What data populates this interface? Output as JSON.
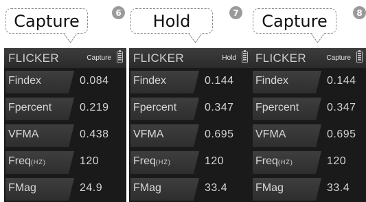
{
  "panels": [
    {
      "callout": "Capture",
      "step": "6",
      "title": "FLICKER",
      "mode": "Capture",
      "rows": [
        {
          "label": "Findex",
          "unit": "",
          "value": "0.084"
        },
        {
          "label": "Fpercent",
          "unit": "",
          "value": "0.219"
        },
        {
          "label": "VFMA",
          "unit": "",
          "value": "0.438"
        },
        {
          "label": "Freq",
          "unit": "(HZ)",
          "value": "120"
        },
        {
          "label": "FMag",
          "unit": "",
          "value": "24.9"
        }
      ]
    },
    {
      "callout": "Hold",
      "step": "7",
      "title": "FLICKER",
      "mode": "Hold",
      "rows": [
        {
          "label": "Findex",
          "unit": "",
          "value": "0.144"
        },
        {
          "label": "Fpercent",
          "unit": "",
          "value": "0.347"
        },
        {
          "label": "VFMA",
          "unit": "",
          "value": "0.695"
        },
        {
          "label": "Freq",
          "unit": "(HZ)",
          "value": "120"
        },
        {
          "label": "FMag",
          "unit": "",
          "value": "33.4"
        }
      ]
    },
    {
      "callout": "Capture",
      "step": "8",
      "title": "FLICKER",
      "mode": "Capture",
      "rows": [
        {
          "label": "Findex",
          "unit": "",
          "value": "0.144"
        },
        {
          "label": "Fpercent",
          "unit": "",
          "value": "0.347"
        },
        {
          "label": "VFMA",
          "unit": "",
          "value": "0.695"
        },
        {
          "label": "Freq",
          "unit": "(HZ)",
          "value": "120"
        },
        {
          "label": "FMag",
          "unit": "",
          "value": "33.4"
        }
      ]
    }
  ],
  "icons": {
    "battery": "battery-icon"
  }
}
